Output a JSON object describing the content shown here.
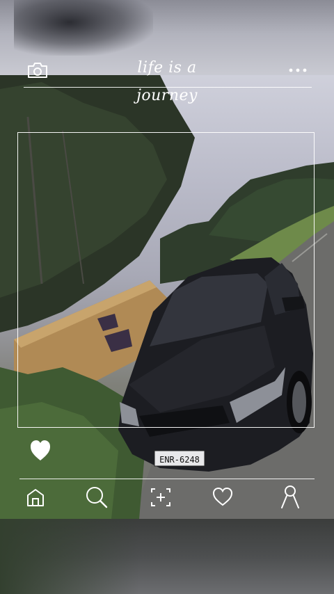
{
  "header": {
    "title": "life is a journey",
    "camera_icon": "camera-icon",
    "more_icon": "more-dots-icon"
  },
  "photo": {
    "license_plate": "ENR-6248"
  },
  "actions": {
    "like_icon": "heart-filled-icon"
  },
  "bottom_nav": {
    "items": [
      {
        "icon": "home-icon"
      },
      {
        "icon": "search-icon"
      },
      {
        "icon": "add-post-icon"
      },
      {
        "icon": "heart-icon"
      },
      {
        "icon": "profile-icon"
      }
    ]
  },
  "colors": {
    "overlay_line": "#ffffff",
    "car_body": "#1c1d22"
  }
}
